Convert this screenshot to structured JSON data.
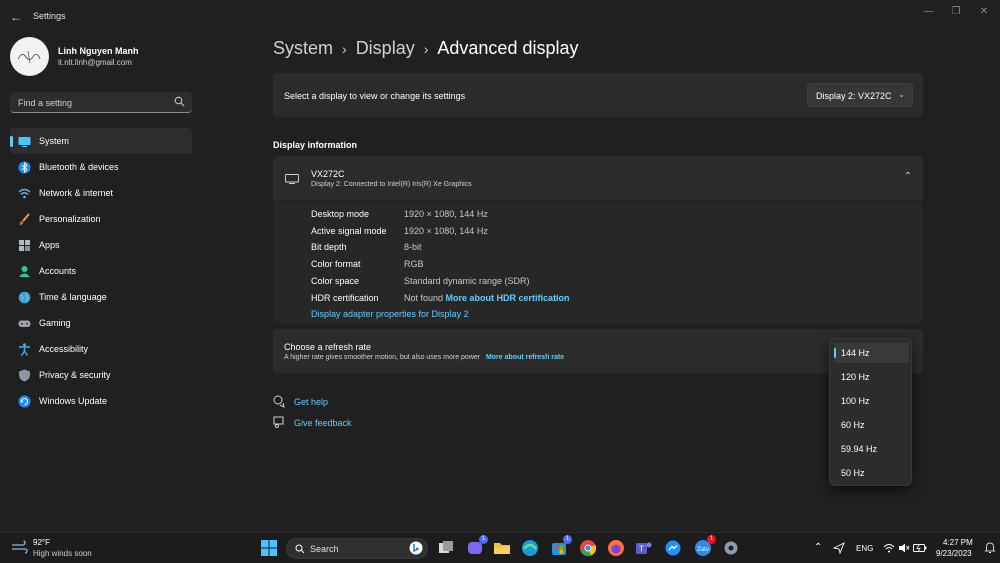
{
  "window": {
    "title": "Settings"
  },
  "profile": {
    "name": "Linh Nguyen Manh",
    "email": "it.nlt.linh@gmail.com"
  },
  "search": {
    "placeholder": "Find a setting"
  },
  "sidebar": {
    "items": [
      {
        "label": "System",
        "icon": "system-icon",
        "active": true
      },
      {
        "label": "Bluetooth & devices",
        "icon": "bluetooth-icon"
      },
      {
        "label": "Network & internet",
        "icon": "wifi-icon"
      },
      {
        "label": "Personalization",
        "icon": "brush-icon"
      },
      {
        "label": "Apps",
        "icon": "apps-icon"
      },
      {
        "label": "Accounts",
        "icon": "accounts-icon"
      },
      {
        "label": "Time & language",
        "icon": "globe-icon"
      },
      {
        "label": "Gaming",
        "icon": "gamepad-icon"
      },
      {
        "label": "Accessibility",
        "icon": "accessibility-icon"
      },
      {
        "label": "Privacy & security",
        "icon": "shield-icon"
      },
      {
        "label": "Windows Update",
        "icon": "update-icon"
      }
    ]
  },
  "breadcrumb": {
    "part1": "System",
    "part2": "Display",
    "current": "Advanced display"
  },
  "display_select": {
    "label": "Select a display to view or change its settings",
    "value": "Display 2: VX272C"
  },
  "display_info": {
    "section_title": "Display information",
    "monitor_name": "VX272C",
    "monitor_sub": "Display 2: Connected to Intel(R) Iris(R) Xe Graphics",
    "rows": [
      {
        "label": "Desktop mode",
        "value": "1920 × 1080, 144 Hz"
      },
      {
        "label": "Active signal mode",
        "value": "1920 × 1080, 144 Hz"
      },
      {
        "label": "Bit depth",
        "value": "8-bit"
      },
      {
        "label": "Color format",
        "value": "RGB"
      },
      {
        "label": "Color space",
        "value": "Standard dynamic range (SDR)"
      },
      {
        "label": "HDR certification",
        "value": "Not found"
      }
    ],
    "hdr_link": "More about HDR certification",
    "adapter_link": "Display adapter properties for Display 2"
  },
  "refresh": {
    "title": "Choose a refresh rate",
    "desc": "A higher rate gives smoother motion, but also uses more power",
    "link": "More about refresh rate",
    "options": [
      "144 Hz",
      "120 Hz",
      "100 Hz",
      "60 Hz",
      "59.94 Hz",
      "50 Hz"
    ],
    "selected": "144 Hz"
  },
  "help": {
    "get_help": "Get help",
    "give_feedback": "Give feedback"
  },
  "taskbar": {
    "weather_temp": "92°F",
    "weather_desc": "High winds soon",
    "search_placeholder": "Search",
    "language": "ENG",
    "time": "4:27 PM",
    "date": "9/23/2023",
    "badges": {
      "teams": "1",
      "store": "1",
      "chat": "1"
    }
  },
  "colors": {
    "accent": "#60cdff",
    "background": "#202020",
    "card": "#2b2b2b"
  }
}
